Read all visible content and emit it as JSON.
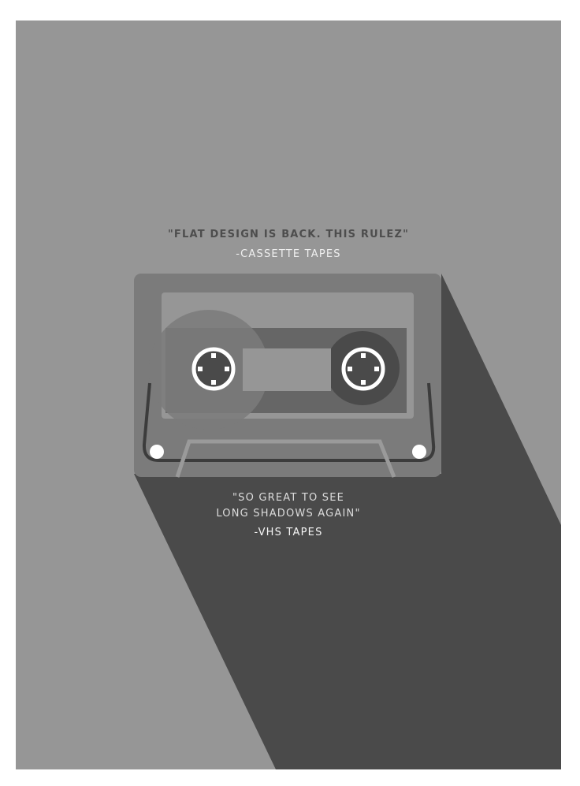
{
  "poster": {
    "quote_top": "\"FLAT DESIGN IS BACK. THIS RULEZ\"",
    "attribution_top": "-CASSETTE TAPES",
    "quote_bottom_line1": "\"SO GREAT TO SEE",
    "quote_bottom_line2": "LONG SHADOWS AGAIN\"",
    "attribution_bottom": "-VHS TAPES"
  },
  "colors": {
    "background": "#969696",
    "shadow": "#4a4a4a",
    "cassette_body": "#7b7b7b",
    "label_window": "#969696",
    "tape_window": "#666666",
    "reel_ring": "#ffffff",
    "text_dark": "#4d4d4d",
    "text_light": "#f0f0f0"
  },
  "icons": [
    "cassette-tape-icon"
  ]
}
